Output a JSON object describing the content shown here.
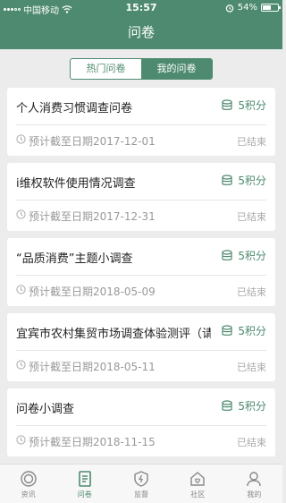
{
  "status_bar": {
    "carrier": "中国移动",
    "time": "15:57",
    "battery": "54%",
    "battery_level": 0.54
  },
  "navbar": {
    "title": "问卷"
  },
  "tabs": [
    {
      "label": "热门问卷",
      "active": false
    },
    {
      "label": "我的问卷",
      "active": true
    }
  ],
  "surveys": [
    {
      "title": "个人消费习惯调查问卷",
      "points": "5积分",
      "deadline": "预计截至日期2017-12-01",
      "status": "已结束"
    },
    {
      "title": "i维权软件使用情况调查",
      "points": "5积分",
      "deadline": "预计截至日期2017-12-31",
      "status": "已结束"
    },
    {
      "title": "“品质消费”主题小调查",
      "points": "5积分",
      "deadline": "预计截至日期2018-05-09",
      "status": "已结束"
    },
    {
      "title": "宜宾市农村集贸市场调查体验测评（请参会...",
      "points": "5积分",
      "deadline": "预计截至日期2018-05-11",
      "status": "已结束"
    },
    {
      "title": "问卷小调查",
      "points": "5积分",
      "deadline": "预计截至日期2018-11-15",
      "status": "已结束"
    }
  ],
  "tabbar": [
    {
      "label": "资讯",
      "icon": "news-icon",
      "active": false
    },
    {
      "label": "问卷",
      "icon": "survey-icon",
      "active": true
    },
    {
      "label": "监督",
      "icon": "shield-icon",
      "active": false
    },
    {
      "label": "社区",
      "icon": "community-icon",
      "active": false
    },
    {
      "label": "我的",
      "icon": "user-icon",
      "active": false
    }
  ],
  "colors": {
    "primary": "#4d8a6f",
    "background": "#ececec",
    "muted": "#999999"
  }
}
